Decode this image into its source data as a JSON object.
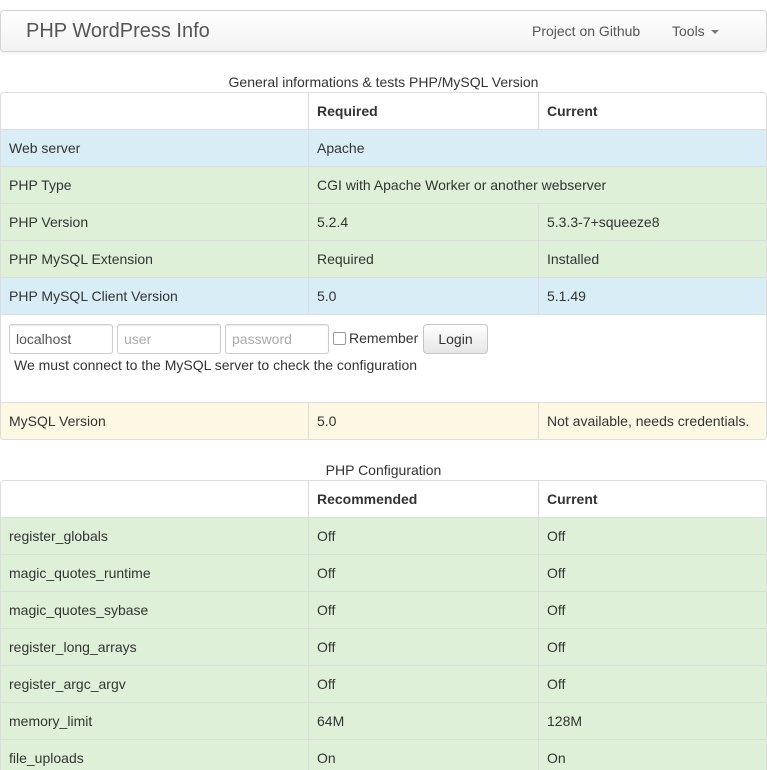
{
  "navbar": {
    "brand": "PHP WordPress Info",
    "github_link": "Project on Github",
    "tools_link": "Tools"
  },
  "general": {
    "caption": "General informations & tests PHP/MySQL Version",
    "headers": [
      "",
      "Required",
      "Current"
    ],
    "rows": [
      {
        "name": "Web server",
        "required": "Apache",
        "current": ""
      },
      {
        "name": "PHP Type",
        "required": "CGI with Apache Worker or another webserver",
        "current": ""
      },
      {
        "name": "PHP Version",
        "required": "5.2.4",
        "current": "5.3.3-7+squeeze8"
      },
      {
        "name": "PHP MySQL Extension",
        "required": "Required",
        "current": "Installed"
      },
      {
        "name": "PHP MySQL Client Version",
        "required": "5.0",
        "current": "5.1.49"
      }
    ],
    "login": {
      "host_value": "localhost",
      "user_placeholder": "user",
      "password_placeholder": "password",
      "remember_label": "Remember",
      "login_button": "Login",
      "note": "We must connect to the MySQL server to check the configuration"
    },
    "mysql_row": {
      "name": "MySQL Version",
      "required": "5.0",
      "current": "Not available, needs credentials."
    }
  },
  "php_config": {
    "caption": "PHP Configuration",
    "headers": [
      "",
      "Recommended",
      "Current"
    ],
    "rows": [
      {
        "name": "register_globals",
        "recommended": "Off",
        "current": "Off"
      },
      {
        "name": "magic_quotes_runtime",
        "recommended": "Off",
        "current": "Off"
      },
      {
        "name": "magic_quotes_sybase",
        "recommended": "Off",
        "current": "Off"
      },
      {
        "name": "register_long_arrays",
        "recommended": "Off",
        "current": "Off"
      },
      {
        "name": "register_argc_argv",
        "recommended": "Off",
        "current": "Off"
      },
      {
        "name": "memory_limit",
        "recommended": "64M",
        "current": "128M"
      },
      {
        "name": "file_uploads",
        "recommended": "On",
        "current": "On"
      }
    ]
  },
  "colors": {
    "info": "#d9edf7",
    "success": "#dff0d8",
    "warning": "#fcf8e3",
    "border": "#dddddd"
  }
}
